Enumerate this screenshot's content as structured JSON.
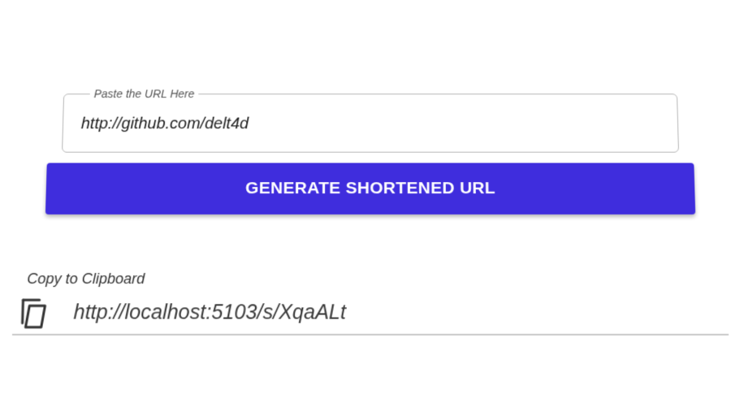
{
  "form": {
    "url_label": "Paste the URL Here",
    "url_value": "http://github.com/delt4d",
    "generate_label": "GENERATE SHORTENED URL"
  },
  "result": {
    "caption": "Copy to Clipboard",
    "short_url": "http://localhost:5103/s/XqaALt",
    "copy_icon": "copy-icon"
  },
  "colors": {
    "accent": "#3f2ddd",
    "border": "#b7b7b7",
    "divider": "#c9c9c9"
  }
}
